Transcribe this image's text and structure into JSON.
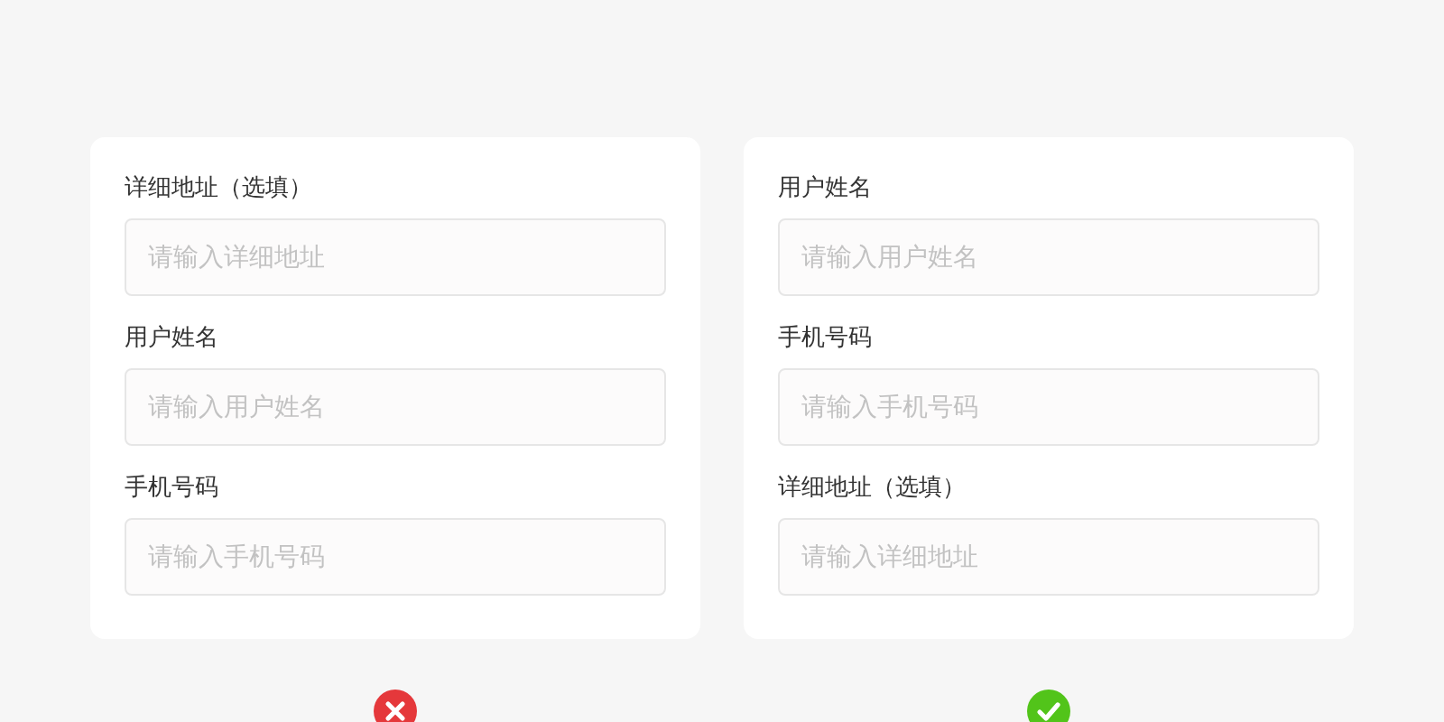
{
  "examples": [
    {
      "correct": false,
      "fields": [
        {
          "label": "详细地址（选填）",
          "placeholder": "请输入详细地址"
        },
        {
          "label": "用户姓名",
          "placeholder": "请输入用户姓名"
        },
        {
          "label": "手机号码",
          "placeholder": "请输入手机号码"
        }
      ]
    },
    {
      "correct": true,
      "fields": [
        {
          "label": "用户姓名",
          "placeholder": "请输入用户姓名"
        },
        {
          "label": "手机号码",
          "placeholder": "请输入手机号码"
        },
        {
          "label": "详细地址（选填）",
          "placeholder": "请输入详细地址"
        }
      ]
    }
  ]
}
